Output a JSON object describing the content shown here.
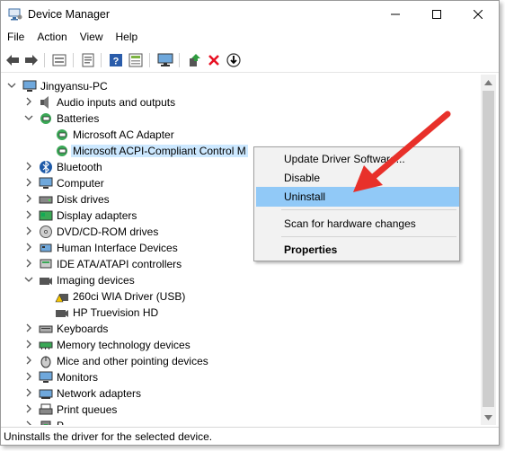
{
  "window": {
    "title": "Device Manager",
    "icons": {
      "app": "device-manager-icon",
      "minimize": "minimize-icon",
      "maximize": "maximize-icon",
      "close": "close-icon"
    }
  },
  "menu": [
    "File",
    "Action",
    "View",
    "Help"
  ],
  "toolbar": {
    "icons": [
      "back-arrow-icon",
      "forward-arrow-icon",
      "device-properties-icon",
      "update-driver-icon",
      "help-icon",
      "show-hidden-icon",
      "monitor-icon",
      "enable-device-icon",
      "uninstall-x-icon",
      "download-arrow-icon"
    ]
  },
  "tree": {
    "root": "Jingyansu-PC",
    "rows": [
      {
        "label": "Audio inputs and outputs",
        "icon": "audio-icon",
        "expander": "collapsed",
        "level": 1
      },
      {
        "label": "Batteries",
        "icon": "battery-icon",
        "expander": "expanded",
        "level": 1
      },
      {
        "label": "Microsoft AC Adapter",
        "icon": "battery-icon",
        "expander": "none",
        "level": 2
      },
      {
        "label": "Microsoft ACPI-Compliant Control M",
        "icon": "battery-icon",
        "expander": "none",
        "level": 2,
        "selected": true
      },
      {
        "label": "Bluetooth",
        "icon": "bluetooth-icon",
        "expander": "collapsed",
        "level": 1
      },
      {
        "label": "Computer",
        "icon": "computer-icon",
        "expander": "collapsed",
        "level": 1
      },
      {
        "label": "Disk drives",
        "icon": "disk-drive-icon",
        "expander": "collapsed",
        "level": 1
      },
      {
        "label": "Display adapters",
        "icon": "display-adapter-icon",
        "expander": "collapsed",
        "level": 1
      },
      {
        "label": "DVD/CD-ROM drives",
        "icon": "dvd-drive-icon",
        "expander": "collapsed",
        "level": 1
      },
      {
        "label": "Human Interface Devices",
        "icon": "hid-icon",
        "expander": "collapsed",
        "level": 1
      },
      {
        "label": "IDE ATA/ATAPI controllers",
        "icon": "ide-controller-icon",
        "expander": "collapsed",
        "level": 1
      },
      {
        "label": "Imaging devices",
        "icon": "camera-icon",
        "expander": "expanded",
        "level": 1
      },
      {
        "label": "260ci WIA Driver (USB)",
        "icon": "warning-camera-icon",
        "expander": "none",
        "level": 2
      },
      {
        "label": "HP Truevision HD",
        "icon": "camera-icon",
        "expander": "none",
        "level": 2
      },
      {
        "label": "Keyboards",
        "icon": "keyboard-icon",
        "expander": "collapsed",
        "level": 1
      },
      {
        "label": "Memory technology devices",
        "icon": "memory-icon",
        "expander": "collapsed",
        "level": 1
      },
      {
        "label": "Mice and other pointing devices",
        "icon": "mouse-icon",
        "expander": "collapsed",
        "level": 1
      },
      {
        "label": "Monitors",
        "icon": "monitor-icon",
        "expander": "collapsed",
        "level": 1
      },
      {
        "label": "Network adapters",
        "icon": "network-icon",
        "expander": "collapsed",
        "level": 1
      },
      {
        "label": "Print queues",
        "icon": "printer-icon",
        "expander": "collapsed",
        "level": 1
      },
      {
        "label": "P",
        "icon": "processor-icon",
        "expander": "collapsed",
        "level": 1
      }
    ]
  },
  "context_menu": {
    "items": [
      {
        "label": "Update Driver Software...",
        "highlighted": false,
        "bold": false
      },
      {
        "label": "Disable",
        "highlighted": false,
        "bold": false
      },
      {
        "label": "Uninstall",
        "highlighted": true,
        "bold": false
      },
      {
        "label": "Scan for hardware changes",
        "highlighted": false,
        "bold": false
      },
      {
        "label": "Properties",
        "highlighted": false,
        "bold": true
      }
    ]
  },
  "status": "Uninstalls the driver for the selected device.",
  "colors": {
    "selection": "#cce8ff",
    "menu_highlight": "#91c9f7",
    "annotation_arrow": "#e8302a",
    "error_x": "#e81123"
  }
}
